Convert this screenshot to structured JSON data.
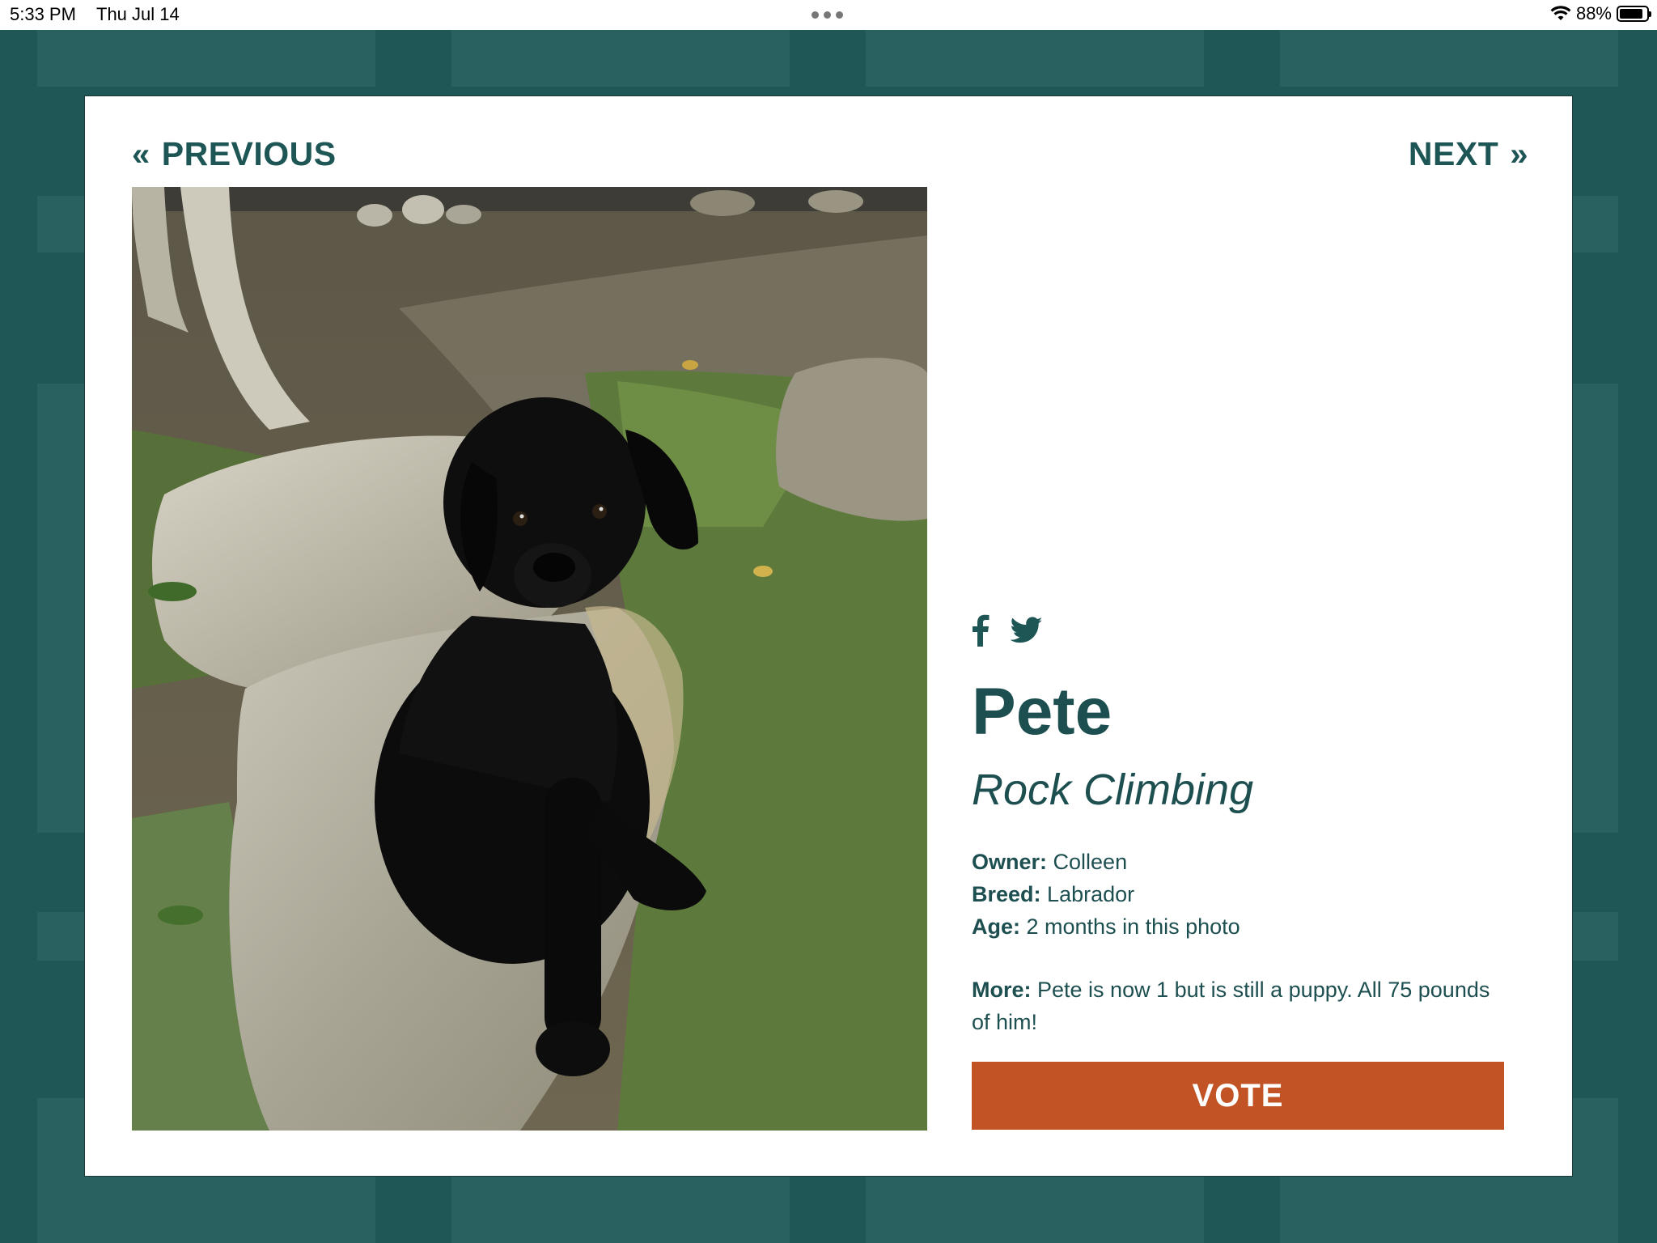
{
  "status_bar": {
    "time": "5:33 PM",
    "date": "Thu Jul 14",
    "battery_percent": "88%",
    "battery_level": 0.88,
    "icons": [
      "wifi-icon",
      "battery-icon",
      "multitask-dots-icon"
    ]
  },
  "nav": {
    "previous_label": "PREVIOUS",
    "next_label": "NEXT",
    "previous_icon": "double-chevron-left-icon",
    "next_icon": "double-chevron-right-icon"
  },
  "photo": {
    "subject": "black labrador puppy sitting on a rock"
  },
  "social": {
    "icons": [
      "facebook-icon",
      "twitter-icon"
    ]
  },
  "pet": {
    "name": "Pete",
    "category": "Rock Climbing",
    "owner_label": "Owner:",
    "owner": "Colleen",
    "breed_label": "Breed:",
    "breed": "Labrador",
    "age_label": "Age:",
    "age": "2 months in this photo",
    "more_label": "More:",
    "more": "Pete is now 1 but is still a puppy. All 75 pounds of him!"
  },
  "vote_button": {
    "label": "VOTE"
  },
  "colors": {
    "background": "#1f5656",
    "text_accent": "#1e4f50",
    "vote_button": "#c15325"
  }
}
